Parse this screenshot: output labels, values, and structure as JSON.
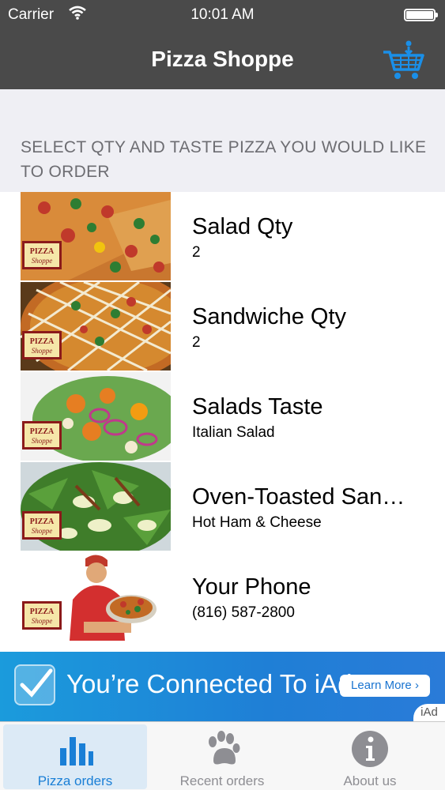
{
  "status_bar": {
    "carrier": "Carrier",
    "time": "10:01 AM"
  },
  "nav": {
    "title": "Pizza Shoppe",
    "cart_icon": "cart-icon"
  },
  "section_header": "SELECT QTY AND TASTE PIZZA YOU WOULD LIKE TO ORDER",
  "items": [
    {
      "label": "Salad Qty",
      "value": "2"
    },
    {
      "label": "Sandwiche Qty",
      "value": "2"
    },
    {
      "label": "Salads Taste",
      "value": "Italian Salad"
    },
    {
      "label": "Oven-Toasted San…",
      "value": "Hot Ham & Cheese"
    },
    {
      "label": "Your Phone",
      "value": "(816) 587-2800"
    }
  ],
  "logo_text": "PIZZA Shoppe",
  "ad": {
    "headline": "You’re Connected To iAd",
    "button": "Learn More",
    "corner": "iAd"
  },
  "tabs": [
    {
      "label": "Pizza orders",
      "icon": "bar-chart-icon",
      "active": true
    },
    {
      "label": "Recent orders",
      "icon": "paw-icon",
      "active": false
    },
    {
      "label": "About us",
      "icon": "info-icon",
      "active": false
    }
  ],
  "colors": {
    "nav_bg": "#4a4a4a",
    "accent": "#1a7fd6",
    "ad_bg": "#1b9bdc"
  }
}
